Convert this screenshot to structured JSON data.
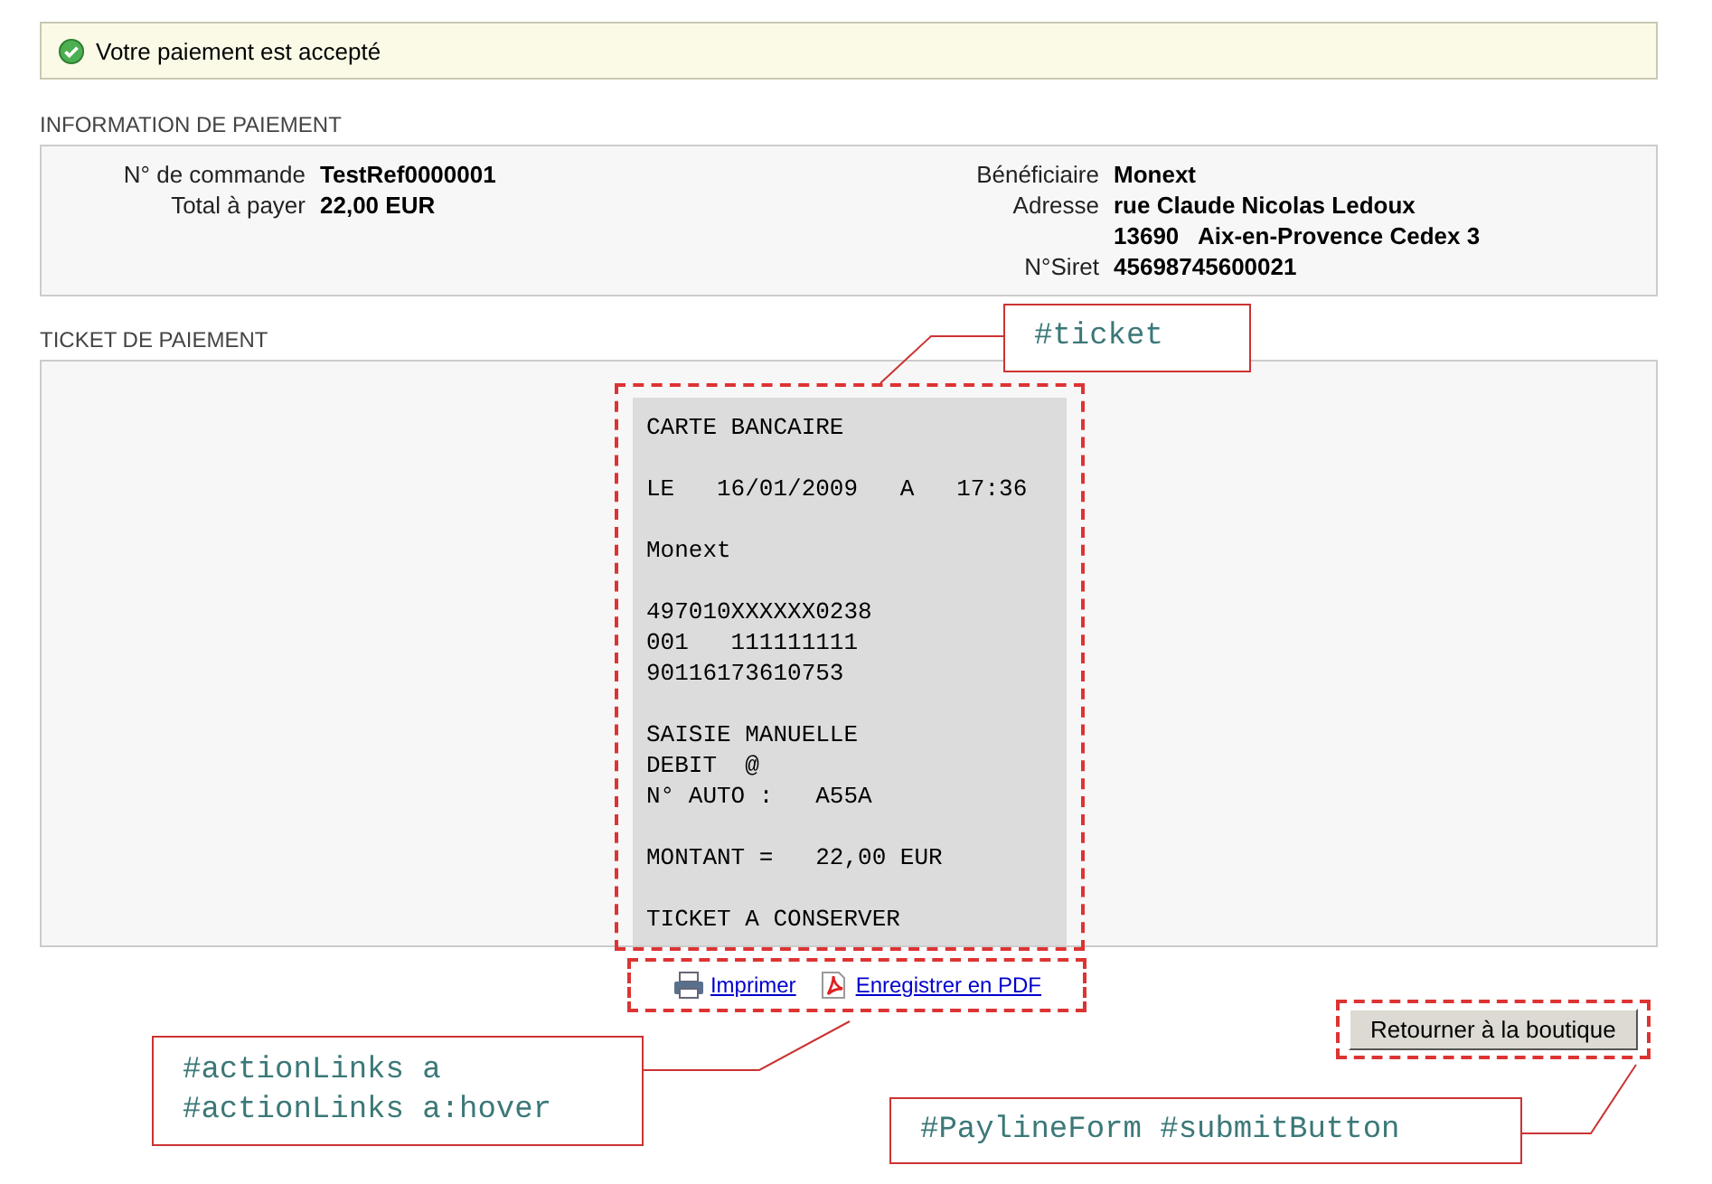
{
  "status": {
    "message": "Votre paiement est accepté"
  },
  "payment_info": {
    "title": "INFORMATION DE PAIEMENT",
    "left": [
      {
        "label": "N° de commande",
        "values": [
          "TestRef0000001"
        ]
      },
      {
        "label": "Total à payer",
        "values": [
          "22,00 EUR"
        ]
      }
    ],
    "right": [
      {
        "label": "Bénéficiaire",
        "values": [
          "Monext"
        ]
      },
      {
        "label": "Adresse",
        "values": [
          "rue Claude Nicolas Ledoux",
          "13690   Aix-en-Provence Cedex 3"
        ]
      },
      {
        "label": "N°Siret",
        "values": [
          "45698745600021"
        ]
      }
    ]
  },
  "ticket": {
    "title": "TICKET DE PAIEMENT",
    "blocks": [
      [
        "CARTE BANCAIRE"
      ],
      [
        "LE   16/01/2009   A   17:36"
      ],
      [
        "Monext"
      ],
      [
        "497010XXXXXX0238",
        "001   111111111",
        "90116173610753"
      ],
      [
        "SAISIE MANUELLE",
        "DEBIT  @",
        "N° AUTO :   A55A"
      ],
      [
        "MONTANT =   22,00 EUR"
      ],
      [
        "TICKET A CONSERVER"
      ]
    ]
  },
  "action_links": [
    {
      "kind": "print",
      "label": "Imprimer"
    },
    {
      "kind": "pdf",
      "label": "Enregistrer en PDF"
    }
  ],
  "submit_button": {
    "label": "Retourner à la boutique"
  },
  "annotations": [
    {
      "kind": "ticket",
      "lines": [
        "#ticket"
      ]
    },
    {
      "kind": "links",
      "lines": [
        "#actionLinks a",
        "#actionLinks a:hover"
      ]
    },
    {
      "kind": "button",
      "lines": [
        "#PaylineForm #submitButton"
      ]
    }
  ]
}
